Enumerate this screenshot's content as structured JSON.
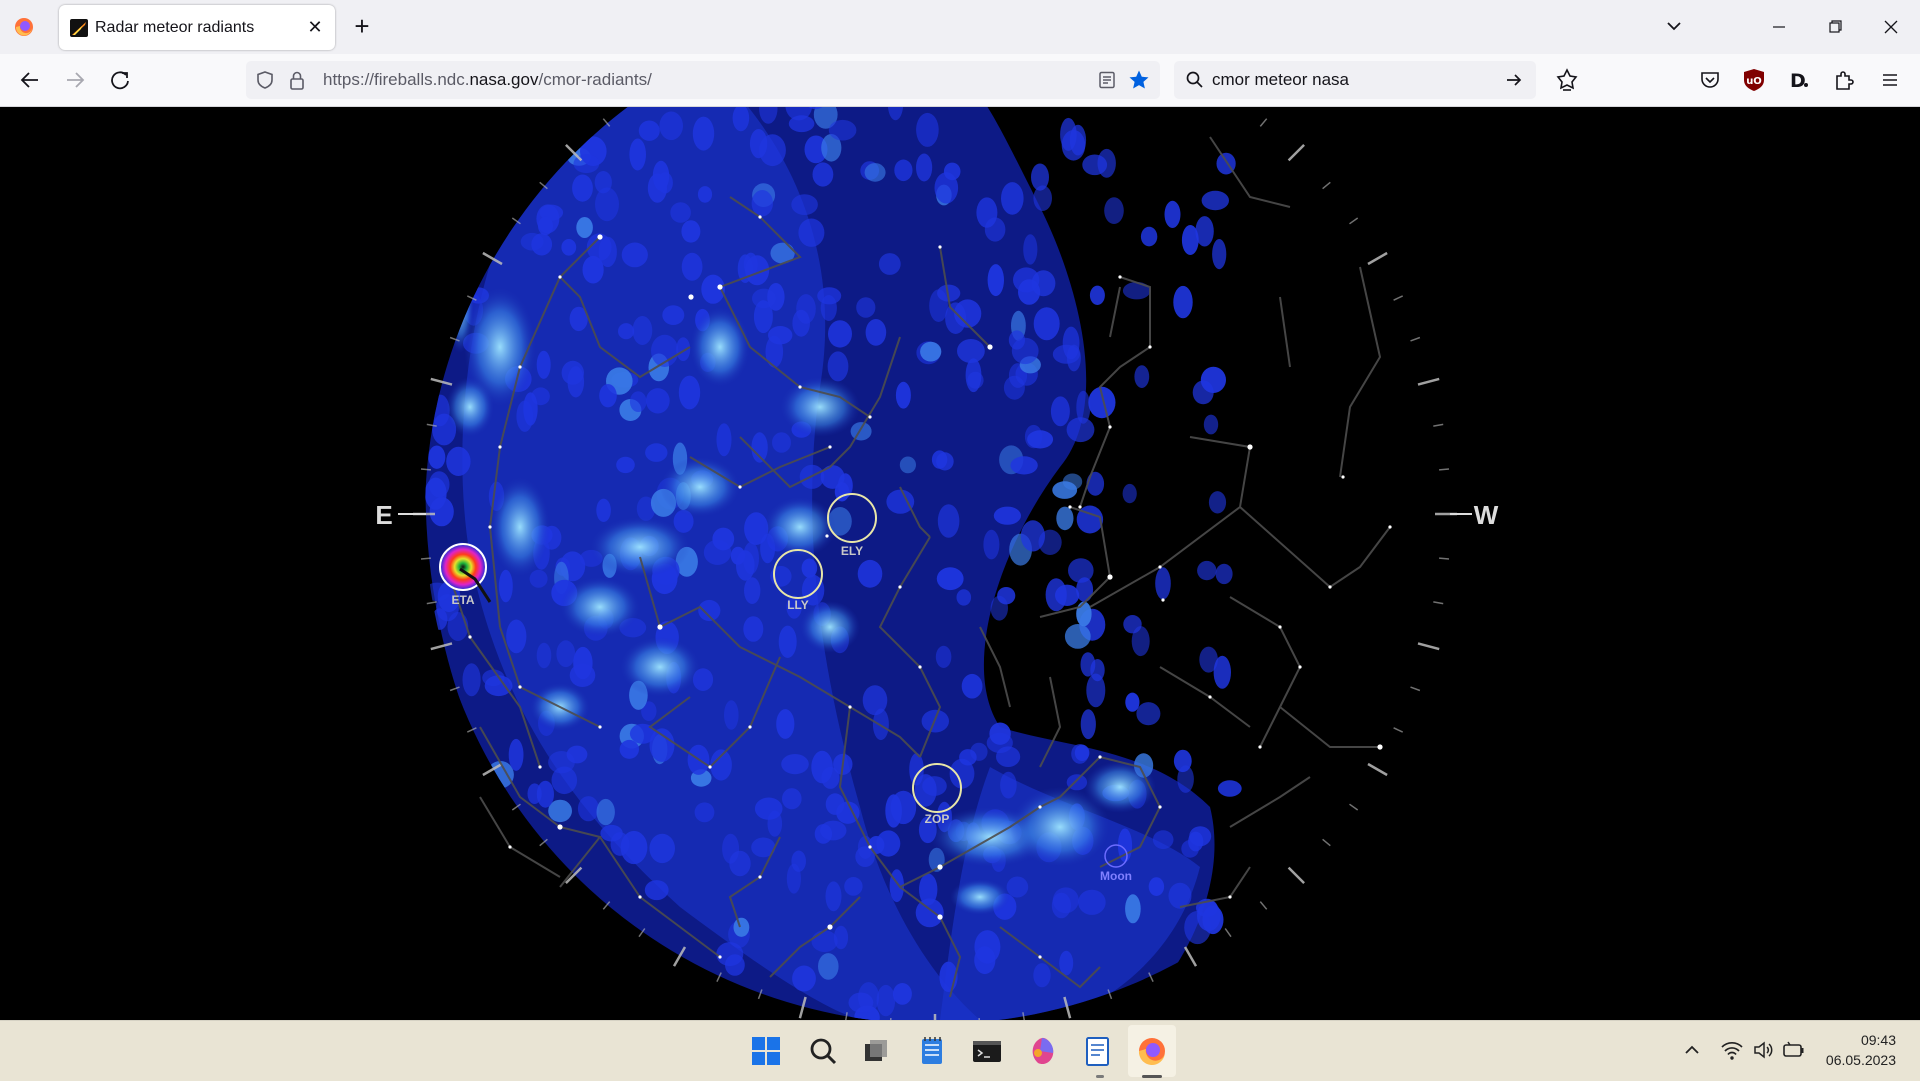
{
  "browser": {
    "tab": {
      "title": "Radar meteor radiants",
      "close_icon": "close-icon"
    },
    "new_tab_icon": "plus-icon",
    "url": {
      "prefix": "https://fireballs.ndc.",
      "domain": "nasa.gov",
      "suffix": "/cmor-radiants/"
    },
    "search_query": "cmor meteor nasa"
  },
  "sky_map": {
    "east_label": "E",
    "west_label": "W",
    "showers": [
      {
        "code": "ETA"
      },
      {
        "code": "ELY"
      },
      {
        "code": "LLY"
      },
      {
        "code": "ZOP"
      }
    ],
    "moon_label": "Moon"
  },
  "taskbar": {
    "time": "09:43",
    "date": "06.05.2023",
    "icons": [
      "windows-start-icon",
      "search-icon",
      "task-view-icon",
      "notepad-icon",
      "terminal-icon",
      "paint-icon",
      "document-icon",
      "firefox-icon"
    ]
  },
  "colors": {
    "sky_blue": "#1a2fb4",
    "density_light": "#7fd9ff",
    "tab_strip": "#f0f0f4",
    "taskbar": "#e9e4d4",
    "bookmark_star": "#0061e0"
  }
}
